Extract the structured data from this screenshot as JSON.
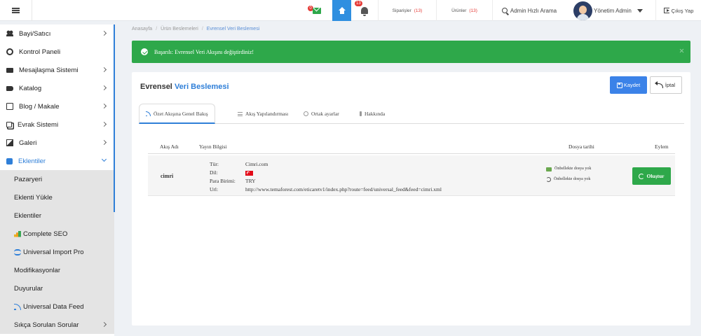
{
  "header": {
    "mail_badge": "0",
    "bell_badge": "13",
    "orders_label": "Siparişler",
    "orders_count": "(13)",
    "products_label": "Ürünler",
    "products_count": "(13)",
    "search_label": "Admin Hızlı Arama",
    "user_name": "Yönetim Admin",
    "logout_label": "Çıkış Yap"
  },
  "sidebar": {
    "items": [
      {
        "label": "Bayi/Satıcı",
        "icon": "users-icon"
      },
      {
        "label": "Kontrol Paneli",
        "icon": "dashboard-icon"
      },
      {
        "label": "Mesajlaşma Sistemi",
        "icon": "envelope-icon"
      },
      {
        "label": "Katalog",
        "icon": "tag-icon"
      },
      {
        "label": "Blog / Makale",
        "icon": "book-icon"
      },
      {
        "label": "Evrak Sistemi",
        "icon": "copy-icon"
      },
      {
        "label": "Galeri",
        "icon": "image-icon"
      },
      {
        "label": "Eklentiler",
        "icon": "puzzle-icon"
      }
    ],
    "sub_items": [
      {
        "label": "Pazaryeri"
      },
      {
        "label": "Eklenti Yükle"
      },
      {
        "label": "Eklentiler"
      },
      {
        "label": "Complete SEO",
        "icon": "seo-chart-icon"
      },
      {
        "label": "Universal Import Pro",
        "icon": "import-icon"
      },
      {
        "label": "Modifikasyonlar"
      },
      {
        "label": "Duyurular"
      },
      {
        "label": "Universal Data Feed",
        "icon": "rss-icon"
      },
      {
        "label": "Sıkça Sorulan Sorular"
      }
    ]
  },
  "breadcrumb": [
    "Anasayfa",
    "Ürün Beslemeleri",
    "Evrensel Veri Beslemesi"
  ],
  "alert": {
    "text": "Başarılı: Evrensel Veri Akışını değiştirdiniz!"
  },
  "card": {
    "title_main": "Evrensel",
    "title_highlight": "Veri Beslemesi",
    "save_label": "Kaydet",
    "cancel_label": "İptal"
  },
  "tabs": [
    {
      "label": "Özet Akışına Genel Bakış",
      "icon": "rss-icon"
    },
    {
      "label": "Akış Yapılandırması",
      "icon": "sliders-icon"
    },
    {
      "label": "Ortak ayarlar",
      "icon": "gear-icon"
    },
    {
      "label": "Hakkında",
      "icon": "info-icon"
    }
  ],
  "table": {
    "headers": {
      "feed_name": "Akış Adı",
      "info": "Yayın Bilgisi",
      "file_date": "Dosya tarihi",
      "action": "Eylem"
    },
    "row": {
      "feed_name": "cimri",
      "type_label": "Tür:",
      "type_value": "Cimri.com",
      "lang_label": "Dil:",
      "currency_label": "Para Birimi:",
      "currency_value": "TRY",
      "url_label": "Url:",
      "url_value": "http://www.temaforest.com/eticaretv1/index.php?route=feed/universal_feed&feed=cimri.xml",
      "cache_1": "Önbellekte dosya yok",
      "cache_2": "Önbellekte dosya yok",
      "create_label": "Oluştur"
    }
  },
  "colors": {
    "accent": "#2f7fd8",
    "success": "#2ea84a",
    "danger": "#e53935"
  }
}
